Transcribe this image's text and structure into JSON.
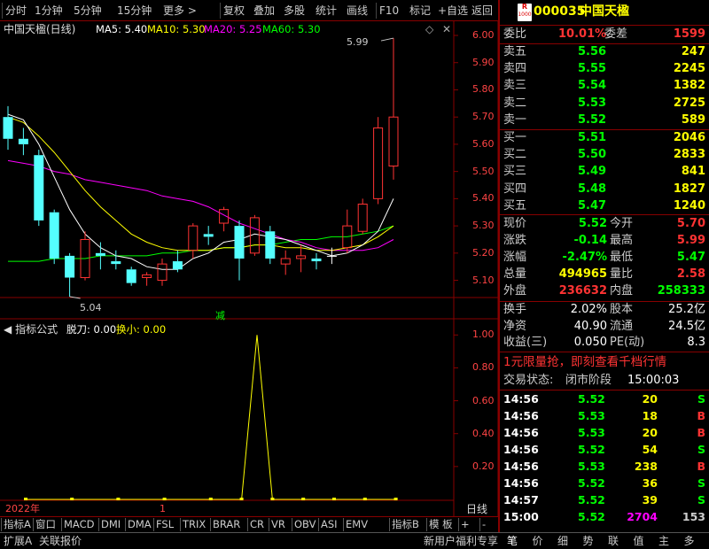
{
  "toolbar": {
    "items": [
      "分时",
      "1分钟",
      "5分钟",
      "15分钟",
      "更多 >",
      "复权",
      "叠加",
      "多股",
      "统计",
      "画线",
      "F10",
      "标记",
      "+自选",
      "返回"
    ]
  },
  "chart": {
    "title": "中国天楹(日线)",
    "ma": [
      {
        "label": "MA5: 5.40",
        "color": "#ffffff"
      },
      {
        "label": "MA10: 5.30",
        "color": "#ffff00"
      },
      {
        "label": "MA20: 5.25",
        "color": "#ff00ff"
      },
      {
        "label": "MA60: 5.30",
        "color": "#00ff00"
      }
    ],
    "price_ticks": [
      "6.00",
      "5.90",
      "5.80",
      "5.70",
      "5.60",
      "5.50",
      "5.40",
      "5.30",
      "5.20",
      "5.10"
    ],
    "high_label": "5.99",
    "low_label": "5.04",
    "signal_label": "减",
    "indicator_title": "指标公式",
    "indicator_values": [
      {
        "label": "脱刀: 0.00",
        "color": "#ffffff"
      },
      {
        "label": "换小: 0.00",
        "color": "#ffff00"
      }
    ],
    "indicator_ticks": [
      "1.00",
      "0.80",
      "0.60",
      "0.40",
      "0.20"
    ],
    "year_label": "2022年",
    "month_label": "1",
    "period_label": "日线"
  },
  "chart_data": {
    "type": "candlestick",
    "candles": [
      {
        "o": 5.7,
        "h": 5.74,
        "l": 5.58,
        "c": 5.62
      },
      {
        "o": 5.62,
        "h": 5.66,
        "l": 5.56,
        "c": 5.6
      },
      {
        "o": 5.56,
        "h": 5.58,
        "l": 5.3,
        "c": 5.32
      },
      {
        "o": 5.35,
        "h": 5.36,
        "l": 5.16,
        "c": 5.18
      },
      {
        "o": 5.19,
        "h": 5.2,
        "l": 5.04,
        "c": 5.11
      },
      {
        "o": 5.11,
        "h": 5.28,
        "l": 5.1,
        "c": 5.25
      },
      {
        "o": 5.2,
        "h": 5.24,
        "l": 5.14,
        "c": 5.19
      },
      {
        "o": 5.17,
        "h": 5.21,
        "l": 5.14,
        "c": 5.16
      },
      {
        "o": 5.14,
        "h": 5.15,
        "l": 5.08,
        "c": 5.09
      },
      {
        "o": 5.11,
        "h": 5.13,
        "l": 5.08,
        "c": 5.12
      },
      {
        "o": 5.1,
        "h": 5.18,
        "l": 5.08,
        "c": 5.16
      },
      {
        "o": 5.17,
        "h": 5.21,
        "l": 5.13,
        "c": 5.14
      },
      {
        "o": 5.21,
        "h": 5.31,
        "l": 5.18,
        "c": 5.3
      },
      {
        "o": 5.27,
        "h": 5.3,
        "l": 5.23,
        "c": 5.26
      },
      {
        "o": 5.31,
        "h": 5.37,
        "l": 5.28,
        "c": 5.36
      },
      {
        "o": 5.3,
        "h": 5.32,
        "l": 5.1,
        "c": 5.18
      },
      {
        "o": 5.2,
        "h": 5.34,
        "l": 5.19,
        "c": 5.33
      },
      {
        "o": 5.28,
        "h": 5.3,
        "l": 5.16,
        "c": 5.18
      },
      {
        "o": 5.16,
        "h": 5.21,
        "l": 5.12,
        "c": 5.18
      },
      {
        "o": 5.18,
        "h": 5.23,
        "l": 5.13,
        "c": 5.19
      },
      {
        "o": 5.18,
        "h": 5.2,
        "l": 5.14,
        "c": 5.17
      },
      {
        "o": 5.19,
        "h": 5.22,
        "l": 5.16,
        "c": 5.19
      },
      {
        "o": 5.22,
        "h": 5.36,
        "l": 5.2,
        "c": 5.3
      },
      {
        "o": 5.28,
        "h": 5.4,
        "l": 5.27,
        "c": 5.38
      },
      {
        "o": 5.4,
        "h": 5.7,
        "l": 5.38,
        "c": 5.66
      },
      {
        "o": 5.52,
        "h": 5.99,
        "l": 5.47,
        "c": 5.7
      }
    ],
    "ma5": [
      5.71,
      5.69,
      5.6,
      5.48,
      5.36,
      5.27,
      5.22,
      5.19,
      5.18,
      5.15,
      5.14,
      5.14,
      5.18,
      5.2,
      5.24,
      5.25,
      5.27,
      5.26,
      5.25,
      5.23,
      5.21,
      5.19,
      5.2,
      5.23,
      5.28,
      5.4
    ],
    "ma10": [
      5.7,
      5.68,
      5.63,
      5.57,
      5.5,
      5.43,
      5.37,
      5.32,
      5.27,
      5.24,
      5.22,
      5.21,
      5.21,
      5.21,
      5.22,
      5.22,
      5.23,
      5.23,
      5.22,
      5.22,
      5.21,
      5.21,
      5.22,
      5.23,
      5.26,
      5.3
    ],
    "ma20": [
      5.54,
      5.53,
      5.52,
      5.5,
      5.49,
      5.47,
      5.46,
      5.45,
      5.44,
      5.43,
      5.41,
      5.4,
      5.39,
      5.37,
      5.34,
      5.31,
      5.29,
      5.27,
      5.25,
      5.24,
      5.22,
      5.21,
      5.21,
      5.21,
      5.22,
      5.25
    ],
    "ma60": [
      5.17,
      5.17,
      5.17,
      5.18,
      5.18,
      5.18,
      5.19,
      5.19,
      5.19,
      5.19,
      5.2,
      5.2,
      5.21,
      5.21,
      5.22,
      5.22,
      5.23,
      5.23,
      5.24,
      5.25,
      5.25,
      5.26,
      5.26,
      5.27,
      5.28,
      5.3
    ],
    "indicator_x_index": [
      0,
      3,
      6,
      9,
      12,
      14,
      15,
      16,
      18,
      20,
      22,
      24
    ],
    "indicator_values": [
      0,
      0,
      0,
      0,
      0,
      0,
      1,
      0,
      0,
      0,
      0,
      0
    ],
    "ylim": [
      5.04,
      6.0
    ],
    "indicator_ylim": [
      0,
      1.05
    ]
  },
  "quote": {
    "code": "000035",
    "name": "中国天楹",
    "badge_top": "R",
    "badge_bottom": "1000",
    "weibi_label": "委比",
    "weibi_value": "10.01%",
    "weicha_label": "委差",
    "weicha_value": "1599",
    "asks": [
      {
        "label": "卖五",
        "price": "5.56",
        "vol": "247"
      },
      {
        "label": "卖四",
        "price": "5.55",
        "vol": "2245"
      },
      {
        "label": "卖三",
        "price": "5.54",
        "vol": "1382"
      },
      {
        "label": "卖二",
        "price": "5.53",
        "vol": "2725"
      },
      {
        "label": "卖一",
        "price": "5.52",
        "vol": "589"
      }
    ],
    "bids": [
      {
        "label": "买一",
        "price": "5.51",
        "vol": "2046"
      },
      {
        "label": "买二",
        "price": "5.50",
        "vol": "2833"
      },
      {
        "label": "买三",
        "price": "5.49",
        "vol": "841"
      },
      {
        "label": "买四",
        "price": "5.48",
        "vol": "1827"
      },
      {
        "label": "买五",
        "price": "5.47",
        "vol": "1240"
      }
    ],
    "stats": [
      {
        "l1": "现价",
        "v1": "5.52",
        "c1": "#00ff00",
        "l2": "今开",
        "v2": "5.70",
        "c2": "#ff3333"
      },
      {
        "l1": "涨跌",
        "v1": "-0.14",
        "c1": "#00ff00",
        "l2": "最高",
        "v2": "5.99",
        "c2": "#ff3333"
      },
      {
        "l1": "涨幅",
        "v1": "-2.47%",
        "c1": "#00ff00",
        "l2": "最低",
        "v2": "5.47",
        "c2": "#00ff00"
      },
      {
        "l1": "总量",
        "v1": "494965",
        "c1": "#ffff00",
        "l2": "量比",
        "v2": "2.58",
        "c2": "#ff3333"
      },
      {
        "l1": "外盘",
        "v1": "236632",
        "c1": "#ff3333",
        "l2": "内盘",
        "v2": "258333",
        "c2": "#00ff00"
      }
    ],
    "stats2": [
      {
        "l1": "换手",
        "v1": "2.02%",
        "l2": "股本",
        "v2": "25.2亿"
      },
      {
        "l1": "净资",
        "v1": "40.90",
        "l2": "流通",
        "v2": "24.5亿"
      },
      {
        "l1": "收益(三)",
        "v1": "0.050",
        "l2": "PE(动)",
        "v2": "8.3"
      }
    ],
    "promo": "1元限量抢，即刻查看千档行情",
    "trade_status_label": "交易状态:",
    "trade_status_value": "闭市阶段",
    "trade_status_time": "15:00:03",
    "ticks": [
      {
        "time": "14:56",
        "price": "5.52",
        "vol": "20",
        "side": "S"
      },
      {
        "time": "14:56",
        "price": "5.53",
        "vol": "18",
        "side": "B"
      },
      {
        "time": "14:56",
        "price": "5.53",
        "vol": "20",
        "side": "B"
      },
      {
        "time": "14:56",
        "price": "5.52",
        "vol": "54",
        "side": "S"
      },
      {
        "time": "14:56",
        "price": "5.53",
        "vol": "238",
        "side": "B"
      },
      {
        "time": "14:56",
        "price": "5.52",
        "vol": "36",
        "side": "S"
      },
      {
        "time": "14:57",
        "price": "5.52",
        "vol": "39",
        "side": "S"
      },
      {
        "time": "15:00",
        "price": "5.52",
        "vol": "2704",
        "side": "153"
      }
    ]
  },
  "bottom_tabs": [
    "指标A",
    "窗口",
    "MACD",
    "DMI",
    "DMA",
    "FSL",
    "TRIX",
    "BRAR",
    "CR",
    "VR",
    "OBV",
    "ASI",
    "EMV",
    "指标B",
    "模 板",
    "+",
    "-"
  ],
  "statusbar": {
    "left": [
      "扩展A",
      "关联报价"
    ],
    "promo": "新用户福利专享",
    "tabs": [
      "笔",
      "价",
      "细",
      "势",
      "联",
      "值",
      "主",
      "多"
    ]
  },
  "colors": {
    "up": "#ff3333",
    "down": "#54ffff",
    "flat": "#ffffff",
    "frame": "#880000"
  }
}
